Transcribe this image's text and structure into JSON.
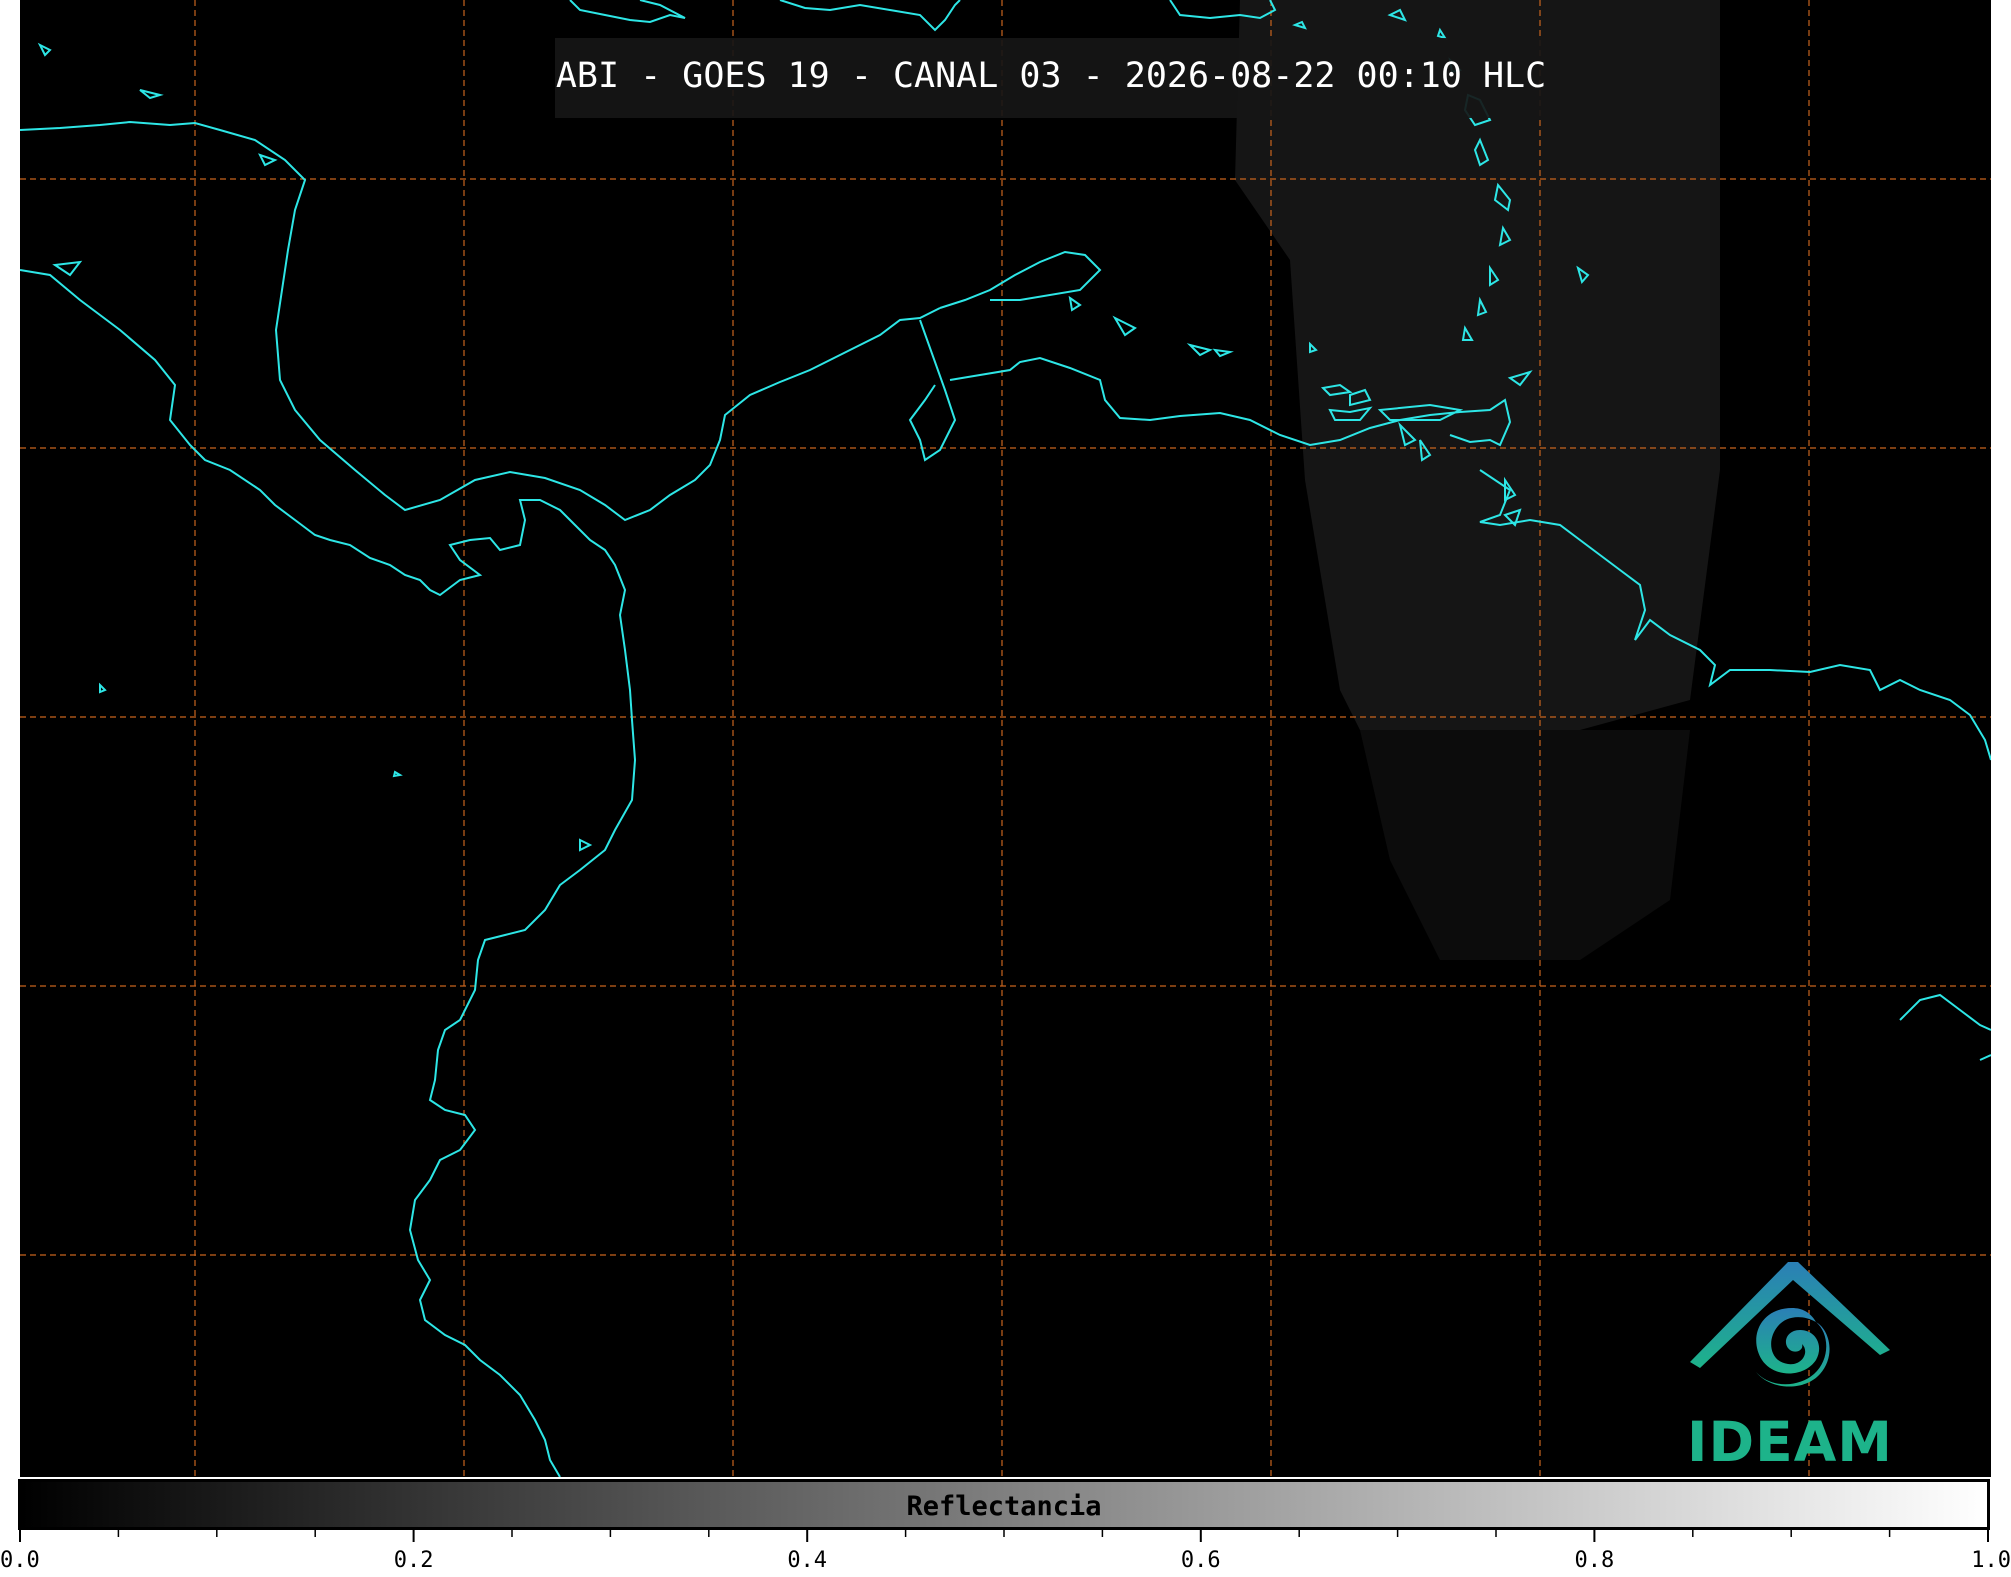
{
  "title": "ABI - GOES 19 - CANAL 03 - 2026-08-22 00:10 HLC",
  "colors": {
    "background": "#000000",
    "coastline": "#2de6e6",
    "gridline": "#c8641e",
    "haze": "#161616",
    "logo_blue": "#2b7fb6",
    "logo_green": "#1db38a"
  },
  "gridlines": {
    "style": "dashed",
    "count_vertical": 7,
    "count_horizontal": 5
  },
  "logo": {
    "text": "IDEAM",
    "icon": "ideam-logo-icon"
  },
  "colorbar": {
    "label": "Reflectancia",
    "min": 0.0,
    "max": 1.0,
    "ticks": [
      "0.0",
      "0.2",
      "0.4",
      "0.6",
      "0.8",
      "1.0"
    ],
    "minor_ticks_between": 3,
    "colors": [
      "#000000",
      "#ffffff"
    ]
  }
}
